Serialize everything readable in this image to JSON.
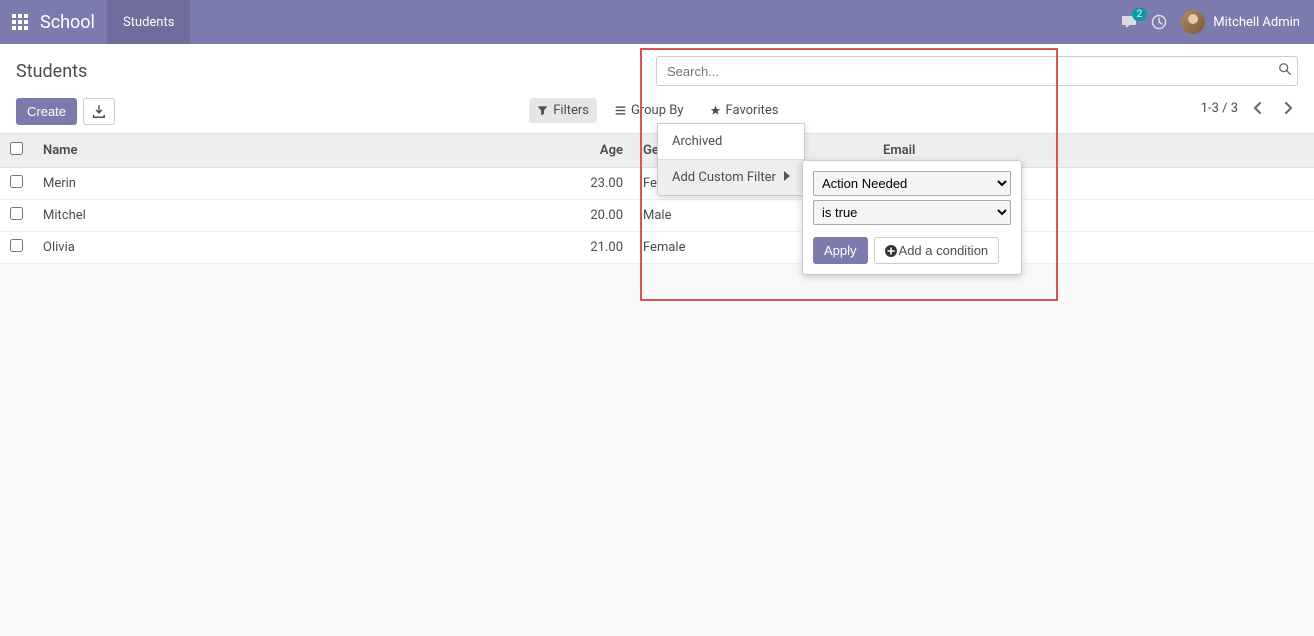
{
  "navbar": {
    "brand": "School",
    "menu_item": "Students",
    "messages_count": "2",
    "username": "Mitchell Admin"
  },
  "breadcrumb": {
    "title": "Students"
  },
  "toolbar": {
    "create_label": "Create"
  },
  "search": {
    "placeholder": "Search...",
    "filters_label": "Filters",
    "groupby_label": "Group By",
    "favorites_label": "Favorites"
  },
  "pager": {
    "text": "1-3 / 3"
  },
  "table": {
    "headers": {
      "name": "Name",
      "age": "Age",
      "gender": "Gender",
      "email": "Email"
    },
    "rows": [
      {
        "name": "Merin",
        "age": "23.00",
        "gender": "Female",
        "email": ""
      },
      {
        "name": "Mitchel",
        "age": "20.00",
        "gender": "Male",
        "email": ""
      },
      {
        "name": "Olivia",
        "age": "21.00",
        "gender": "Female",
        "email": ""
      }
    ]
  },
  "filter_dropdown": {
    "archived_label": "Archived",
    "add_custom_label": "Add Custom Filter"
  },
  "custom_filter": {
    "field_selected": "Action Needed",
    "operator_selected": "is true",
    "apply_label": "Apply",
    "add_condition_label": "Add a condition"
  }
}
